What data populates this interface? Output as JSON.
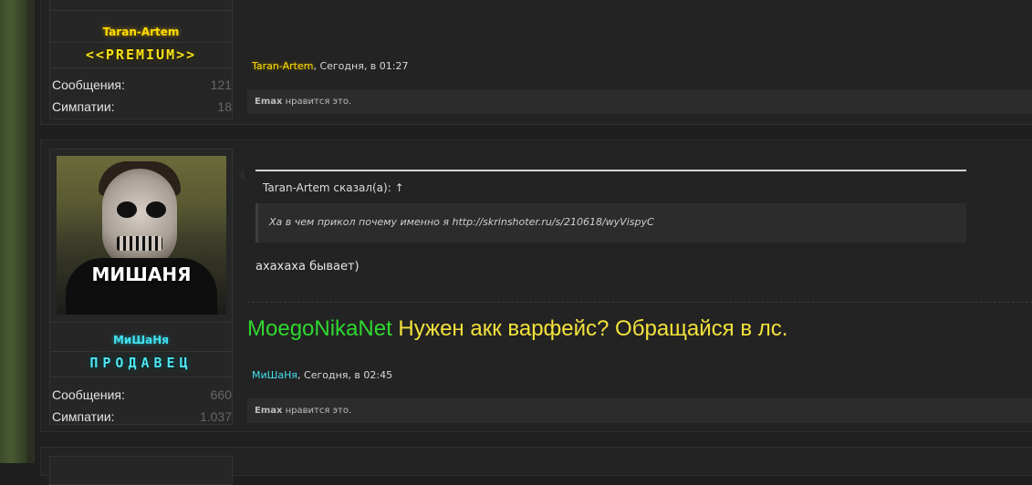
{
  "posts": [
    {
      "author": {
        "name": "Taran-Artem",
        "rank": "<<PREMIUM>>",
        "color": "#ffde00"
      },
      "stats": [
        {
          "label": "Сообщения:",
          "value": "121"
        },
        {
          "label": "Симпатии:",
          "value": "18"
        }
      ],
      "meta": {
        "author": "Taran-Artem",
        "time": ", Сегодня, в 01:27"
      },
      "likes": {
        "user": "Emax",
        "text": " нравится это."
      }
    },
    {
      "author": {
        "name": "МиШаНя",
        "rank": "ПРОДАВЕЦ",
        "color": "#42e0ee",
        "avatar_text": "МИШАНЯ"
      },
      "stats": [
        {
          "label": "Сообщения:",
          "value": "660"
        },
        {
          "label": "Симпатии:",
          "value": "1.037"
        }
      ],
      "quote": {
        "header": "Taran-Artem сказал(а): ↑",
        "text": "Ха в чем прикол почему именно я http://skrinshoter.ru/s/210618/wyVispyC"
      },
      "message": "ахахаха бывает)",
      "signature": {
        "green": "MoegoNikaNet",
        "yellow": " Нужен акк варфейс? Обращайся в лс."
      },
      "meta": {
        "author": "МиШаНя",
        "time": ", Сегодня, в 02:45"
      },
      "likes": {
        "user": "Emax",
        "text": " нравится это."
      }
    }
  ]
}
